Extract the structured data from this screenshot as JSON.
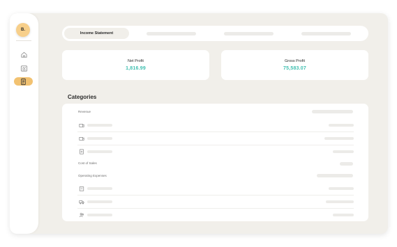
{
  "sidebar": {
    "avatar_initial": "B.",
    "nav": [
      {
        "name": "home-icon"
      },
      {
        "name": "report-icon"
      },
      {
        "name": "statement-icon",
        "active": true
      }
    ]
  },
  "tabs": {
    "active_label": "Income Statement"
  },
  "cards": [
    {
      "label": "Net Profit",
      "value": "1,816.99"
    },
    {
      "label": "Gross Profit",
      "value": "75,583.07"
    }
  ],
  "categories": {
    "title": "Categories",
    "revenue_label": "Revenue",
    "cost_of_sales_label": "Cost of Sales",
    "operating_expenses_label": "Operating Expenses"
  },
  "colors": {
    "accent": "#f2c271",
    "value_teal": "#3fbfb0",
    "background": "#f1efea"
  }
}
